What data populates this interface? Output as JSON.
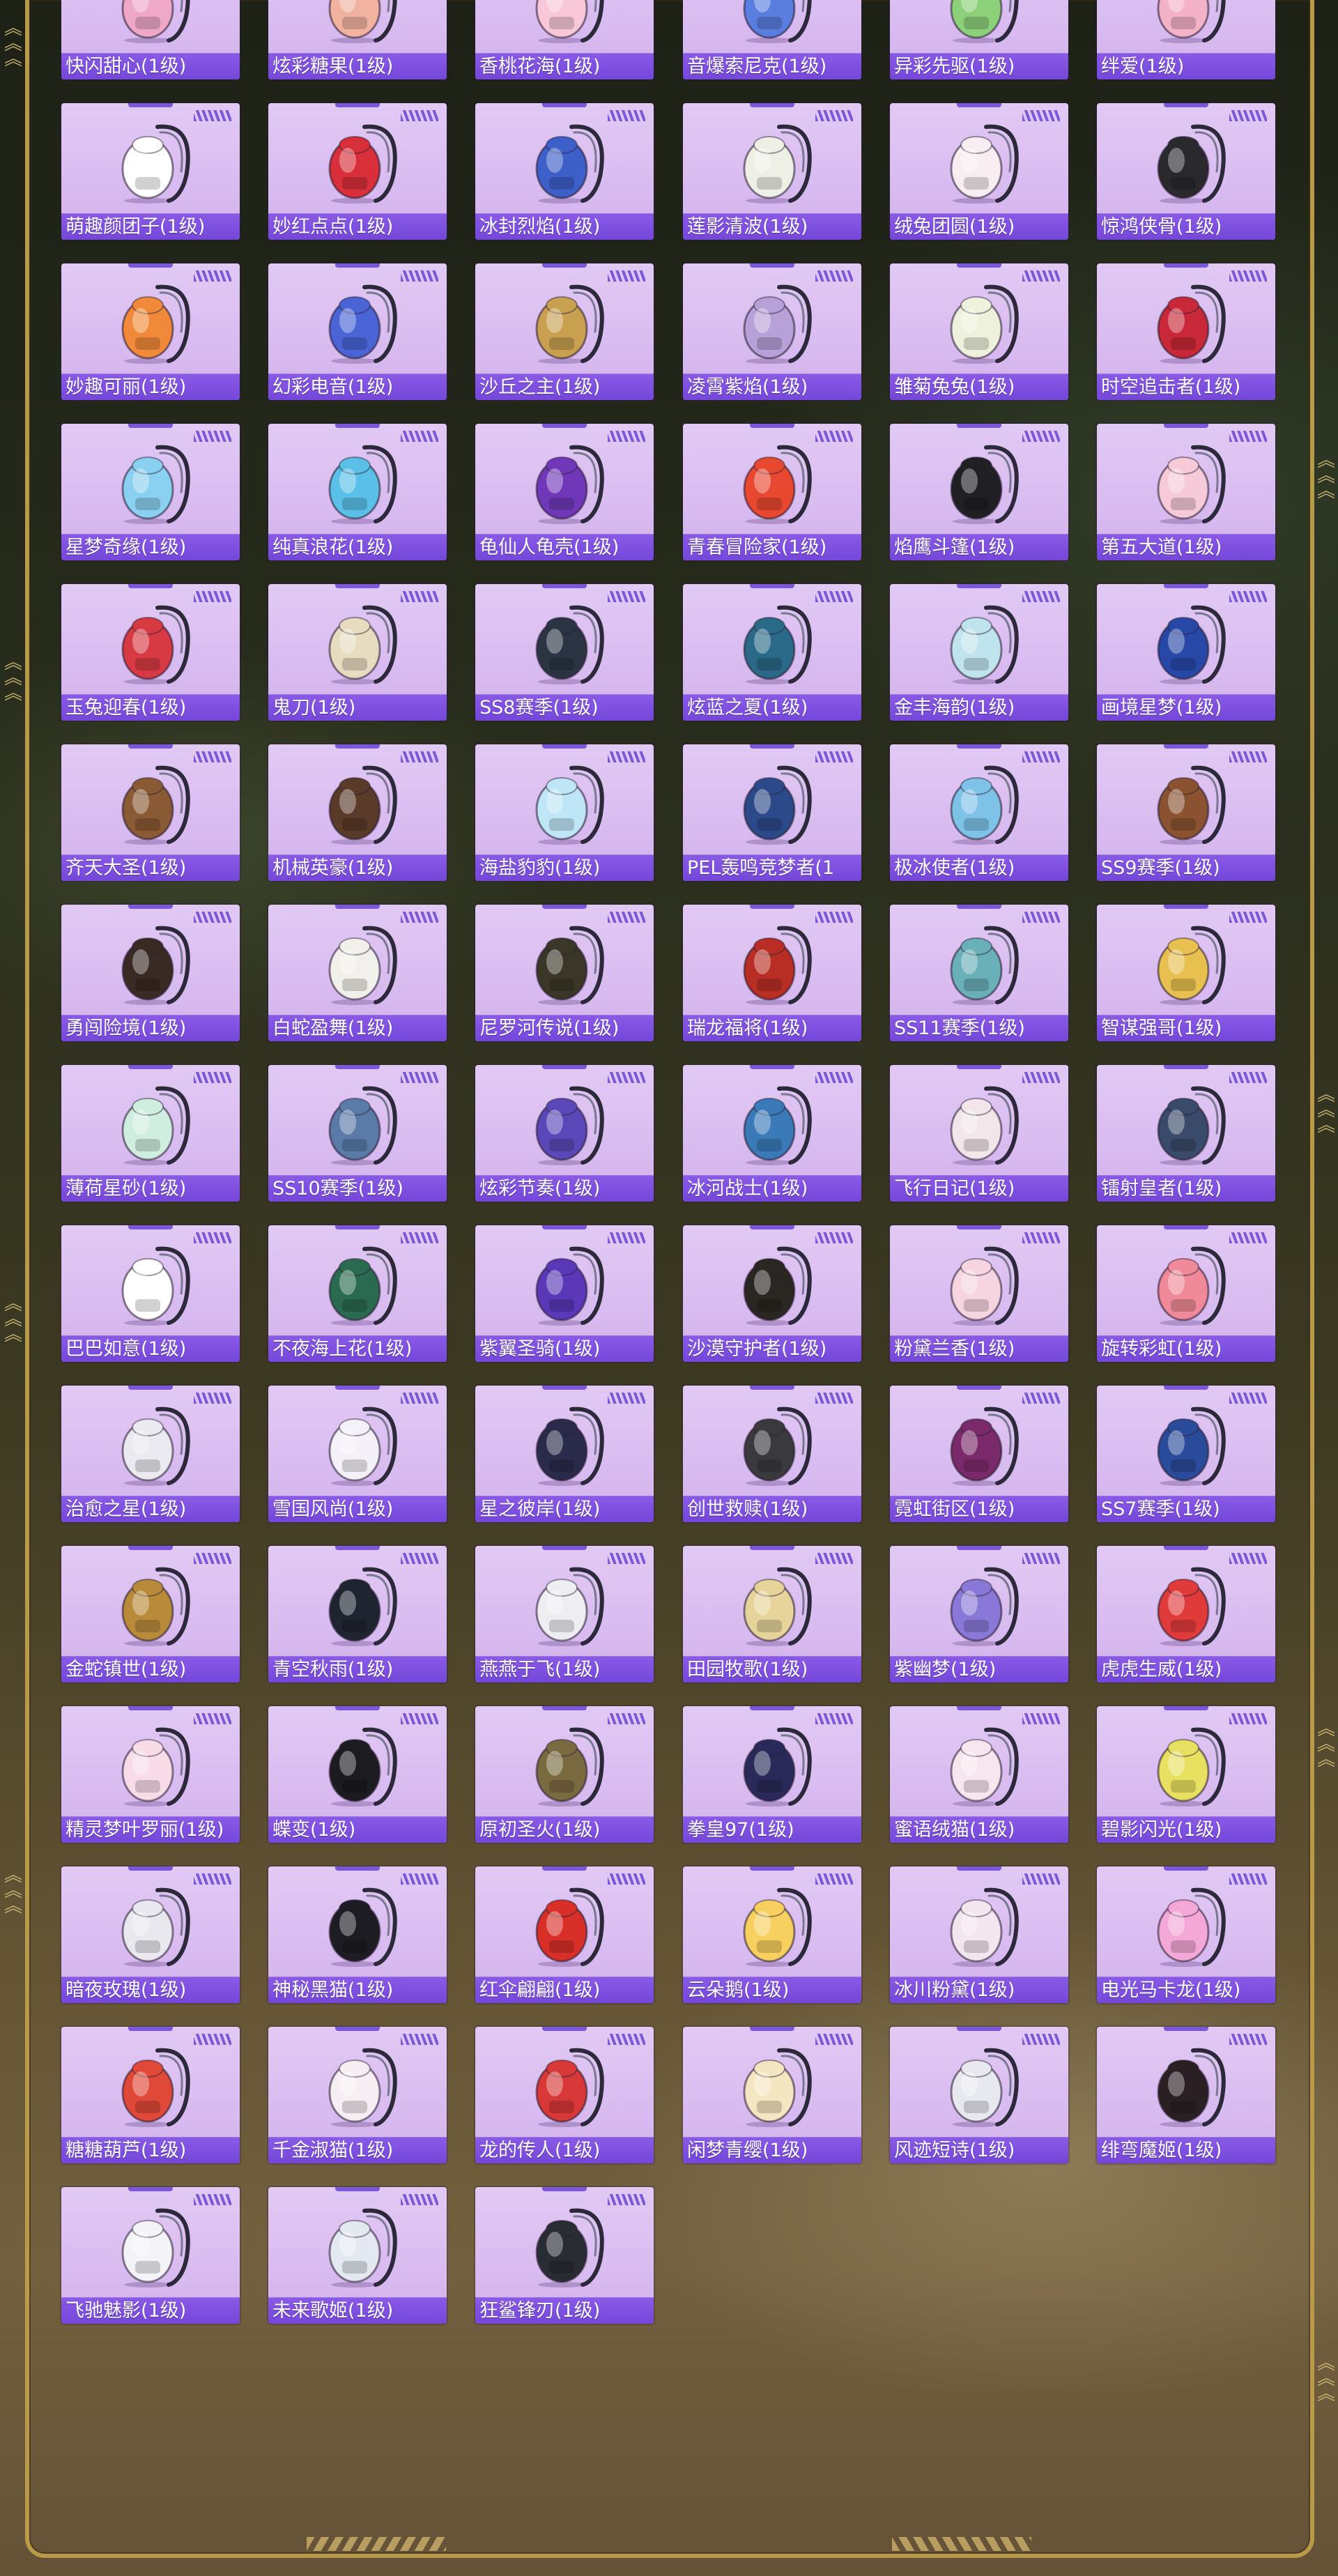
{
  "theme": {
    "tile_bg": "#dcc0f2",
    "label_bg": "#8257e3",
    "frame_gold": "#b89a4a"
  },
  "items": [
    {
      "label": "快闪甜心(1级)",
      "color": "#f0a8c8",
      "icon": "backpack-icon"
    },
    {
      "label": "炫彩糖果(1级)",
      "color": "#f2b2a0",
      "icon": "backpack-icon"
    },
    {
      "label": "香桃花海(1级)",
      "color": "#f8c8d8",
      "icon": "backpack-icon"
    },
    {
      "label": "音爆索尼克(1级)",
      "color": "#5a7de0",
      "icon": "backpack-icon"
    },
    {
      "label": "异彩先驱(1级)",
      "color": "#8cd07a",
      "icon": "backpack-icon"
    },
    {
      "label": "绊爱(1级)",
      "color": "#f4b2c8",
      "icon": "backpack-icon"
    },
    {
      "label": "萌趣颜团子(1级)",
      "color": "#ffffff",
      "icon": "backpack-icon"
    },
    {
      "label": "妙红点点(1级)",
      "color": "#d82f3a",
      "icon": "backpack-icon"
    },
    {
      "label": "冰封烈焰(1级)",
      "color": "#3d5fc8",
      "icon": "backpack-icon"
    },
    {
      "label": "莲影清波(1级)",
      "color": "#eef0e6",
      "icon": "backpack-icon"
    },
    {
      "label": "绒兔团圆(1级)",
      "color": "#f8eef2",
      "icon": "backpack-icon"
    },
    {
      "label": "惊鸿侠骨(1级)",
      "color": "#2a2a2e",
      "icon": "backpack-icon"
    },
    {
      "label": "妙趣可丽(1级)",
      "color": "#f08a3a",
      "icon": "backpack-icon"
    },
    {
      "label": "幻彩电音(1级)",
      "color": "#4a64d6",
      "icon": "backpack-icon"
    },
    {
      "label": "沙丘之主(1级)",
      "color": "#c8a050",
      "icon": "backpack-icon"
    },
    {
      "label": "凌霄紫焰(1级)",
      "color": "#b8a0d8",
      "icon": "backpack-icon"
    },
    {
      "label": "雏菊兔兔(1级)",
      "color": "#eef2dc",
      "icon": "backpack-icon"
    },
    {
      "label": "时空追击者(1级)",
      "color": "#c82838",
      "icon": "backpack-icon"
    },
    {
      "label": "星梦奇缘(1级)",
      "color": "#8ad0f0",
      "icon": "backpack-icon"
    },
    {
      "label": "纯真浪花(1级)",
      "color": "#5ac0e8",
      "icon": "backpack-icon"
    },
    {
      "label": "龟仙人龟壳(1级)",
      "color": "#7038b8",
      "icon": "backpack-icon"
    },
    {
      "label": "青春冒险家(1级)",
      "color": "#e84830",
      "icon": "backpack-icon"
    },
    {
      "label": "焰鹰斗篷(1级)",
      "color": "#202024",
      "icon": "backpack-icon"
    },
    {
      "label": "第五大道(1级)",
      "color": "#f6cad8",
      "icon": "backpack-icon"
    },
    {
      "label": "玉兔迎春(1级)",
      "color": "#d83a44",
      "icon": "backpack-icon"
    },
    {
      "label": "鬼刀(1级)",
      "color": "#e8dcc0",
      "icon": "backpack-icon"
    },
    {
      "label": "SS8赛季(1级)",
      "color": "#2a3442",
      "icon": "backpack-icon"
    },
    {
      "label": "炫蓝之夏(1级)",
      "color": "#2a6a88",
      "icon": "backpack-icon"
    },
    {
      "label": "金丰海韵(1级)",
      "color": "#c0e4ee",
      "icon": "backpack-icon"
    },
    {
      "label": "画境星梦(1级)",
      "color": "#2848a8",
      "icon": "backpack-icon"
    },
    {
      "label": "齐天大圣(1级)",
      "color": "#8a5a34",
      "icon": "backpack-icon"
    },
    {
      "label": "机械英豪(1级)",
      "color": "#5a3a28",
      "icon": "backpack-icon"
    },
    {
      "label": "海盐豹豹(1级)",
      "color": "#bfe6f6",
      "icon": "backpack-icon"
    },
    {
      "label": "PEL轰鸣竞梦者(1",
      "color": "#2c4a8a",
      "icon": "backpack-icon"
    },
    {
      "label": "极冰使者(1级)",
      "color": "#7ec2e8",
      "icon": "backpack-icon"
    },
    {
      "label": "SS9赛季(1级)",
      "color": "#8a5230",
      "icon": "backpack-icon"
    },
    {
      "label": "勇闯险境(1级)",
      "color": "#3a2a24",
      "icon": "backpack-icon"
    },
    {
      "label": "白蛇盈舞(1级)",
      "color": "#f2f0ea",
      "icon": "backpack-icon"
    },
    {
      "label": "尼罗河传说(1级)",
      "color": "#3a3628",
      "icon": "backpack-icon"
    },
    {
      "label": "瑞龙福将(1级)",
      "color": "#b82e24",
      "icon": "backpack-icon"
    },
    {
      "label": "SS11赛季(1级)",
      "color": "#6ab0b8",
      "icon": "backpack-icon"
    },
    {
      "label": "智谋强哥(1级)",
      "color": "#e8c050",
      "icon": "backpack-icon"
    },
    {
      "label": "薄荷星砂(1级)",
      "color": "#cfeee0",
      "icon": "backpack-icon"
    },
    {
      "label": "SS10赛季(1级)",
      "color": "#5a7aa8",
      "icon": "backpack-icon"
    },
    {
      "label": "炫彩节奏(1级)",
      "color": "#5a48b8",
      "icon": "backpack-icon"
    },
    {
      "label": "冰河战士(1级)",
      "color": "#3a7ab8",
      "icon": "backpack-icon"
    },
    {
      "label": "飞行日记(1级)",
      "color": "#f2e6ea",
      "icon": "backpack-icon"
    },
    {
      "label": "镭射皇者(1级)",
      "color": "#3a4a6a",
      "icon": "backpack-icon"
    },
    {
      "label": "巴巴如意(1级)",
      "color": "#ffffff",
      "icon": "backpack-icon"
    },
    {
      "label": "不夜海上花(1级)",
      "color": "#2a6a50",
      "icon": "backpack-icon"
    },
    {
      "label": "紫翼圣骑(1级)",
      "color": "#5a38b8",
      "icon": "backpack-icon"
    },
    {
      "label": "沙漠守护者(1级)",
      "color": "#2a2622",
      "icon": "backpack-icon"
    },
    {
      "label": "粉黛兰香(1级)",
      "color": "#f6d4e0",
      "icon": "backpack-icon"
    },
    {
      "label": "旋转彩虹(1级)",
      "color": "#f08a9a",
      "icon": "backpack-icon"
    },
    {
      "label": "治愈之星(1级)",
      "color": "#eaeaf0",
      "icon": "backpack-icon"
    },
    {
      "label": "雪国风尚(1级)",
      "color": "#f4f2f8",
      "icon": "backpack-icon"
    },
    {
      "label": "星之彼岸(1级)",
      "color": "#2a2a4a",
      "icon": "backpack-icon"
    },
    {
      "label": "创世救赎(1级)",
      "color": "#3a3a3e",
      "icon": "backpack-icon"
    },
    {
      "label": "霓虹街区(1级)",
      "color": "#7a2a6a",
      "icon": "backpack-icon"
    },
    {
      "label": "SS7赛季(1级)",
      "color": "#2a4a9a",
      "icon": "backpack-icon"
    },
    {
      "label": "金蛇镇世(1级)",
      "color": "#b88a3a",
      "icon": "backpack-icon"
    },
    {
      "label": "青空秋雨(1级)",
      "color": "#1e2430",
      "icon": "backpack-icon"
    },
    {
      "label": "燕燕于飞(1级)",
      "color": "#eeeef2",
      "icon": "backpack-icon"
    },
    {
      "label": "田园牧歌(1级)",
      "color": "#e6d49a",
      "icon": "backpack-icon"
    },
    {
      "label": "紫幽梦(1级)",
      "color": "#8a78d8",
      "icon": "backpack-icon"
    },
    {
      "label": "虎虎生威(1级)",
      "color": "#e03a3a",
      "icon": "backpack-icon"
    },
    {
      "label": "精灵梦叶罗丽(1级)",
      "color": "#f8dce8",
      "icon": "backpack-icon"
    },
    {
      "label": "蝶变(1级)",
      "color": "#1c1c20",
      "icon": "backpack-icon"
    },
    {
      "label": "原初圣火(1级)",
      "color": "#7a6a40",
      "icon": "backpack-icon"
    },
    {
      "label": "拳皇97(1级)",
      "color": "#2a2a5a",
      "icon": "backpack-icon"
    },
    {
      "label": "蜜语绒猫(1级)",
      "color": "#f8e6ee",
      "icon": "backpack-icon"
    },
    {
      "label": "碧影闪光(1级)",
      "color": "#e8e060",
      "icon": "backpack-icon"
    },
    {
      "label": "暗夜玫瑰(1级)",
      "color": "#e8e8ee",
      "icon": "backpack-icon"
    },
    {
      "label": "神秘黑猫(1级)",
      "color": "#1c1c22",
      "icon": "backpack-icon"
    },
    {
      "label": "红伞翩翩(1级)",
      "color": "#d83028",
      "icon": "backpack-icon"
    },
    {
      "label": "云朵鹅(1级)",
      "color": "#f8d060",
      "icon": "backpack-icon"
    },
    {
      "label": "冰川粉黛(1级)",
      "color": "#f4e6ee",
      "icon": "backpack-icon"
    },
    {
      "label": "电光马卡龙(1级)",
      "color": "#f4a8d8",
      "icon": "backpack-icon"
    },
    {
      "label": "糖糖葫芦(1级)",
      "color": "#e04838",
      "icon": "backpack-icon"
    },
    {
      "label": "千金淑猫(1级)",
      "color": "#f6eef2",
      "icon": "backpack-icon"
    },
    {
      "label": "龙的传人(1级)",
      "color": "#d83838",
      "icon": "backpack-icon"
    },
    {
      "label": "闲梦青缨(1级)",
      "color": "#f4e6c0",
      "icon": "backpack-icon"
    },
    {
      "label": "风迹短诗(1级)",
      "color": "#e8e8f0",
      "icon": "backpack-icon"
    },
    {
      "label": "绯弯魔姬(1级)",
      "color": "#2a2024",
      "icon": "backpack-icon"
    },
    {
      "label": "飞驰魅影(1级)",
      "color": "#f4f4f8",
      "icon": "backpack-icon"
    },
    {
      "label": "未来歌姬(1级)",
      "color": "#e4e8f0",
      "icon": "backpack-icon"
    },
    {
      "label": "狂鲨锋刃(1级)",
      "color": "#2a2c34",
      "icon": "backpack-icon"
    }
  ]
}
